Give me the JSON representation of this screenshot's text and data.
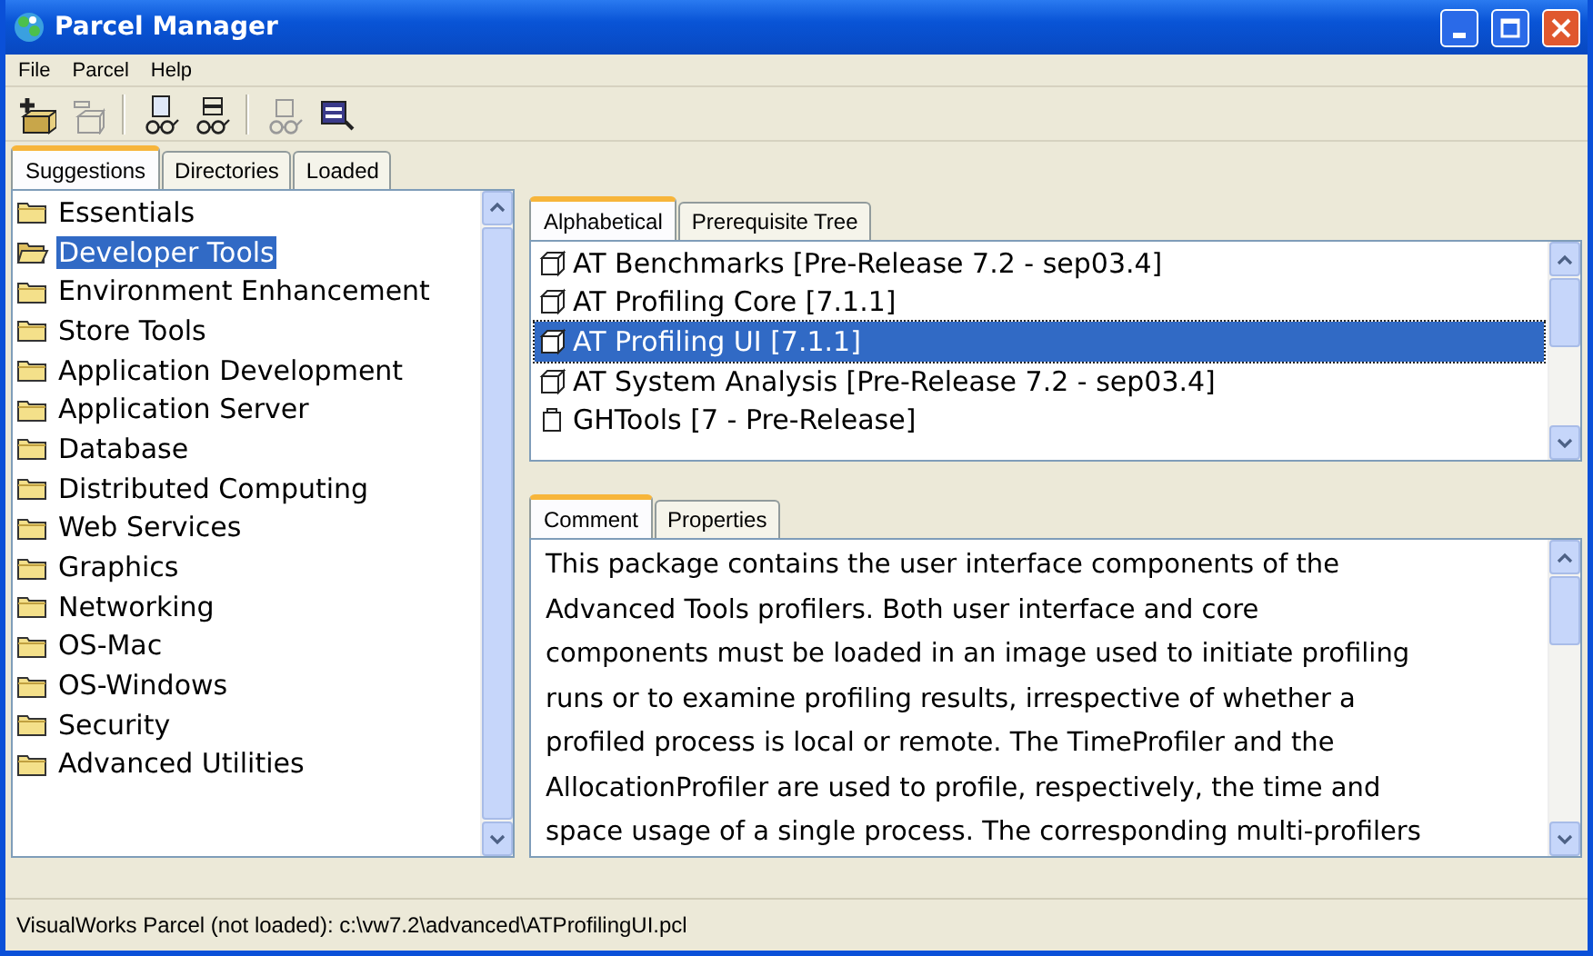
{
  "window": {
    "title": "Parcel Manager"
  },
  "menu": [
    "File",
    "Parcel",
    "Help"
  ],
  "toolbar": [
    {
      "kind": "add",
      "disabled": false
    },
    {
      "kind": "remove",
      "disabled": true
    },
    {
      "kind": "inspect-page",
      "disabled": false
    },
    {
      "kind": "inspect-list",
      "disabled": false
    },
    {
      "kind": "inspect-parcel",
      "disabled": true
    },
    {
      "kind": "terminal",
      "disabled": false
    }
  ],
  "left_tabs": [
    {
      "label": "Suggestions",
      "selected": true
    },
    {
      "label": "Directories",
      "selected": false
    },
    {
      "label": "Loaded",
      "selected": false
    }
  ],
  "categories": [
    {
      "label": "Essentials",
      "selected": false
    },
    {
      "label": "Developer Tools",
      "selected": true
    },
    {
      "label": "Environment Enhancement",
      "selected": false
    },
    {
      "label": "Store Tools",
      "selected": false
    },
    {
      "label": "Application Development",
      "selected": false
    },
    {
      "label": "Application Server",
      "selected": false
    },
    {
      "label": "Database",
      "selected": false
    },
    {
      "label": "Distributed Computing",
      "selected": false
    },
    {
      "label": "Web Services",
      "selected": false
    },
    {
      "label": "Graphics",
      "selected": false
    },
    {
      "label": "Networking",
      "selected": false
    },
    {
      "label": "OS-Mac",
      "selected": false
    },
    {
      "label": "OS-Windows",
      "selected": false
    },
    {
      "label": "Security",
      "selected": false
    },
    {
      "label": "Advanced Utilities",
      "selected": false
    }
  ],
  "parcel_tabs": [
    {
      "label": "Alphabetical",
      "selected": true
    },
    {
      "label": "Prerequisite Tree",
      "selected": false
    }
  ],
  "parcels": [
    {
      "label": "AT Benchmarks [Pre-Release 7.2 - sep03.4]",
      "kind": "parcel",
      "selected": false
    },
    {
      "label": "AT Profiling Core [7.1.1]",
      "kind": "parcel",
      "selected": false
    },
    {
      "label": "AT Profiling UI [7.1.1]",
      "kind": "parcel",
      "selected": true
    },
    {
      "label": "AT System Analysis [Pre-Release 7.2 - sep03.4]",
      "kind": "parcel",
      "selected": false
    },
    {
      "label": "GHTools [7 - Pre-Release]",
      "kind": "bag",
      "selected": false
    }
  ],
  "detail_tabs": [
    {
      "label": "Comment",
      "selected": true
    },
    {
      "label": "Properties",
      "selected": false
    }
  ],
  "comment_lines": [
    "This package contains the user interface components of the",
    "Advanced Tools profilers.  Both user interface and core",
    "components must be loaded in an image used to initiate profiling",
    "runs or to examine profiling results, irrespective of whether a",
    "profiled process is local or remote.  The TimeProfiler and the",
    "AllocationProfiler are used to profile, respectively, the time and",
    "space usage of a single process.  The corresponding multi-profilers"
  ],
  "status_bar": "VisualWorks Parcel (not loaded): c:\\vw7.2\\advanced\\ATProfilingUI.pcl"
}
